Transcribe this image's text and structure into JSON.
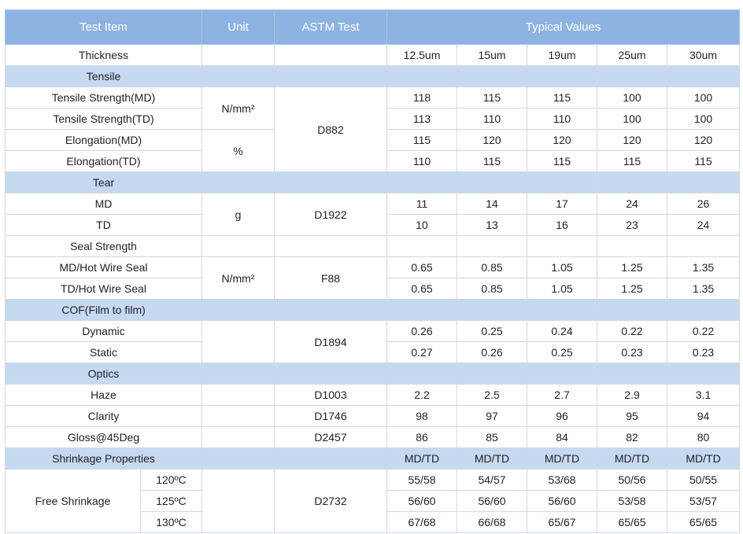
{
  "header": {
    "test_item": "Test Item",
    "unit": "Unit",
    "astm": "ASTM Test",
    "typical": "Typical Values"
  },
  "thickness": {
    "label": "Thickness",
    "values": [
      "12.5um",
      "15um",
      "19um",
      "25um",
      "30um"
    ]
  },
  "tensile": {
    "label": "Tensile",
    "unit_strength": "N/mm²",
    "unit_elong": "%",
    "astm": "D882",
    "rows": [
      {
        "label": "Tensile Strength(MD)",
        "values": [
          "118",
          "115",
          "115",
          "100",
          "100"
        ]
      },
      {
        "label": "Tensile Strength(TD)",
        "values": [
          "113",
          "110",
          "110",
          "100",
          "100"
        ]
      },
      {
        "label": "Elongation(MD)",
        "values": [
          "115",
          "120",
          "120",
          "120",
          "120"
        ]
      },
      {
        "label": "Elongation(TD)",
        "values": [
          "110",
          "115",
          "115",
          "115",
          "115"
        ]
      }
    ]
  },
  "tear": {
    "label": "Tear",
    "unit": "g",
    "astm": "D1922",
    "rows": [
      {
        "label": "MD",
        "values": [
          "11",
          "14",
          "17",
          "24",
          "26"
        ]
      },
      {
        "label": "TD",
        "values": [
          "10",
          "13",
          "16",
          "23",
          "24"
        ]
      }
    ]
  },
  "seal": {
    "label": "Seal Strength",
    "unit": "N/mm²",
    "astm": "F88",
    "rows": [
      {
        "label": "MD/Hot Wire Seal",
        "values": [
          "0.65",
          "0.85",
          "1.05",
          "1.25",
          "1.35"
        ]
      },
      {
        "label": "TD/Hot Wire Seal",
        "values": [
          "0.65",
          "0.85",
          "1.05",
          "1.25",
          "1.35"
        ]
      }
    ]
  },
  "cof": {
    "label": "COF(Film to film)",
    "astm": "D1894",
    "rows": [
      {
        "label": "Dynamic",
        "values": [
          "0.26",
          "0.25",
          "0.24",
          "0.22",
          "0.22"
        ]
      },
      {
        "label": "Static",
        "values": [
          "0.27",
          "0.26",
          "0.25",
          "0.23",
          "0.23"
        ]
      }
    ]
  },
  "optics": {
    "label": "Optics",
    "rows": [
      {
        "label": "Haze",
        "astm": "D1003",
        "values": [
          "2.2",
          "2.5",
          "2.7",
          "2.9",
          "3.1"
        ]
      },
      {
        "label": "Clarity",
        "astm": "D1746",
        "values": [
          "98",
          "97",
          "96",
          "95",
          "94"
        ]
      },
      {
        "label": "Gloss@45Deg",
        "astm": "D2457",
        "values": [
          "86",
          "85",
          "84",
          "82",
          "80"
        ]
      }
    ]
  },
  "shrinkage": {
    "label": "Shrinkage Properties",
    "values": [
      "MD/TD",
      "MD/TD",
      "MD/TD",
      "MD/TD",
      "MD/TD"
    ],
    "free_label": "Free Shrinkage",
    "astm": "D2732",
    "rows": [
      {
        "temp": "120ºC",
        "values": [
          "55/58",
          "54/57",
          "53/68",
          "50/56",
          "50/55"
        ]
      },
      {
        "temp": "125ºC",
        "values": [
          "56/60",
          "56/60",
          "56/60",
          "53/58",
          "53/57"
        ]
      },
      {
        "temp": "130ºC",
        "values": [
          "67/68",
          "66/68",
          "65/67",
          "65/65",
          "65/65"
        ]
      }
    ]
  }
}
